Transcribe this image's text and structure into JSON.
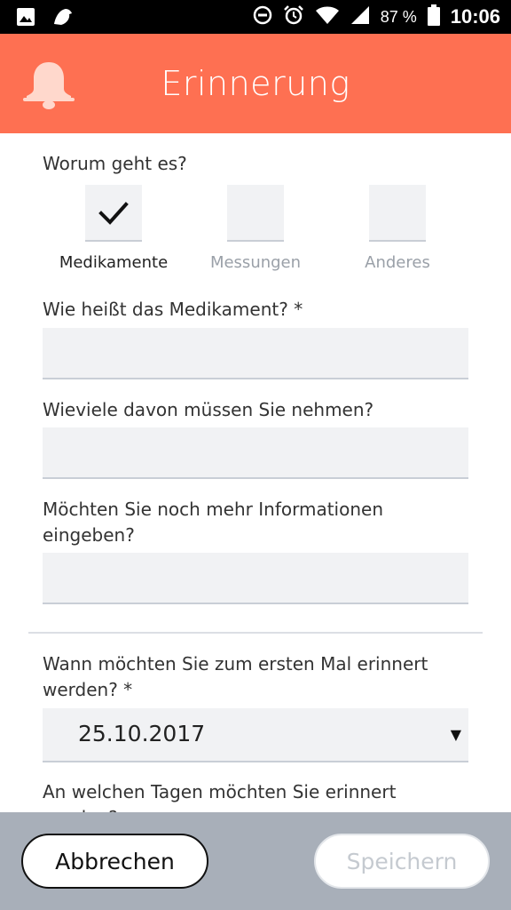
{
  "status_bar": {
    "battery_text": "87 %",
    "time": "10:06",
    "icons": [
      "image-icon",
      "bird-icon",
      "dnd-icon",
      "alarm-icon",
      "wifi-icon",
      "signal-icon",
      "battery-icon"
    ]
  },
  "header": {
    "title": "Erinnerung",
    "icon": "bell-icon",
    "color": "#FE7052"
  },
  "category": {
    "question": "Worum geht es?",
    "options": [
      {
        "label": "Medikamente",
        "selected": true
      },
      {
        "label": "Messungen",
        "selected": false
      },
      {
        "label": "Anderes",
        "selected": false
      }
    ]
  },
  "form": {
    "medication_name": {
      "label": "Wie heißt das Medikament? *",
      "value": ""
    },
    "quantity": {
      "label": "Wieviele davon müssen Sie nehmen?",
      "value": ""
    },
    "more_info": {
      "label_line1": "Möchten Sie noch mehr Informationen",
      "label_line2": "eingeben?",
      "value": ""
    },
    "first_reminder": {
      "label_line1": "Wann möchten Sie zum ersten Mal erinnert",
      "label_line2": "werden? *",
      "value": "25.10.2017"
    },
    "days": {
      "label_line1": "An welchen Tagen möchten Sie erinnert",
      "label_line2": "werden?"
    }
  },
  "footer": {
    "cancel_label": "Abbrechen",
    "save_label": "Speichern"
  }
}
